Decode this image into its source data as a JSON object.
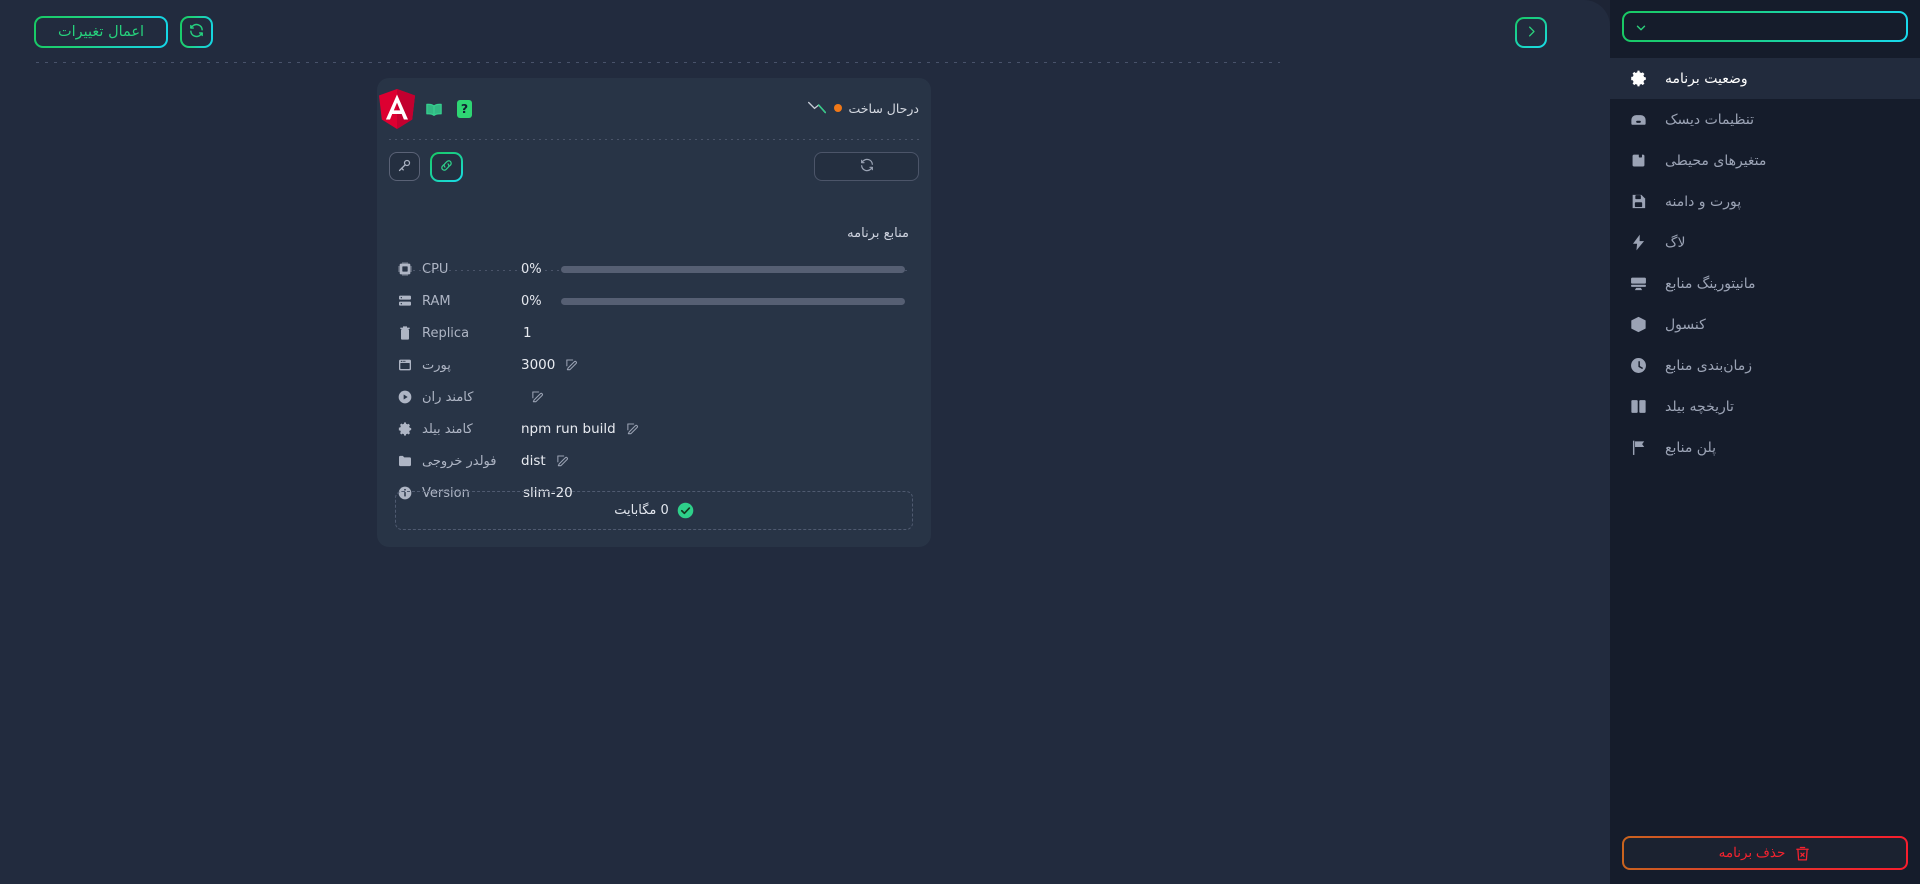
{
  "toolbar": {
    "apply_label": "اعمال تغییرات",
    "refresh_icon": "refresh-icon",
    "collapse_icon": "chevron-right-icon"
  },
  "card": {
    "status_text": "درحال ساخت",
    "status_color": "#f07818",
    "sparkline_icon": "sparkline-icon",
    "docs_icon": "book-icon",
    "help_label": "?",
    "logo_label": "A",
    "logo_color": "#dd0031",
    "tools": {
      "refresh_icon": "refresh-icon",
      "key_icon": "key-icon",
      "link_icon": "link-icon"
    },
    "resources_title": "منابع برنامه",
    "rows": [
      {
        "icon": "cpu-icon",
        "label": "CPU",
        "type": "progress",
        "value": "0%",
        "percent": 0
      },
      {
        "icon": "ram-icon",
        "label": "RAM",
        "type": "progress",
        "value": "0%",
        "percent": 0
      },
      {
        "icon": "replica-icon",
        "label": "Replica",
        "type": "plain",
        "value": "1"
      },
      {
        "icon": "window-icon",
        "label": "پورت",
        "type": "editable",
        "value": "3000"
      },
      {
        "icon": "play-icon",
        "label": "کامند ران",
        "type": "editable",
        "value": ""
      },
      {
        "icon": "gear-icon",
        "label": "کامند بیلد",
        "type": "editable",
        "value": "npm run build"
      },
      {
        "icon": "folder-icon",
        "label": "فولدر خروجی",
        "type": "editable",
        "value": "dist"
      },
      {
        "icon": "info-icon",
        "label": "Version",
        "type": "plain",
        "value": "20-slim"
      }
    ],
    "footer": {
      "icon": "check-circle-icon",
      "text": "0 مگابایت"
    }
  },
  "sidebar": {
    "selector": {
      "value": "",
      "icon": "chevron-down-icon"
    },
    "items": [
      {
        "label": "وضعیت برنامه",
        "icon": "gear-icon",
        "active": true
      },
      {
        "label": "تنظیمات دیسک",
        "icon": "hdd-icon",
        "active": false
      },
      {
        "label": "متغیرهای محیطی",
        "icon": "memory-icon",
        "active": false
      },
      {
        "label": "پورت و دامنه",
        "icon": "floppy-icon",
        "active": false
      },
      {
        "label": "لاگ",
        "icon": "bolt-icon",
        "active": false
      },
      {
        "label": "مانیتورینگ منابع",
        "icon": "monitor-icon",
        "active": false
      },
      {
        "label": "کنسول",
        "icon": "box-icon",
        "active": false
      },
      {
        "label": "زمان‌بندی منابع",
        "icon": "clock-icon",
        "active": false
      },
      {
        "label": "تاریخچه بیلد",
        "icon": "book-open-icon",
        "active": false
      },
      {
        "label": "پلن منابع",
        "icon": "flag-icon",
        "active": false
      }
    ],
    "delete_button": {
      "label": "حذف برنامه",
      "icon": "trash-x-icon",
      "color": "#f5232f"
    }
  },
  "colors": {
    "page_bg": "#181f2e",
    "panel_bg": "#222b3e",
    "card_bg": "#283446",
    "sidebar_bg": "#151c2b",
    "accent_green": "#18c964",
    "accent_cyan": "#19dced",
    "danger": "#f5232f"
  }
}
